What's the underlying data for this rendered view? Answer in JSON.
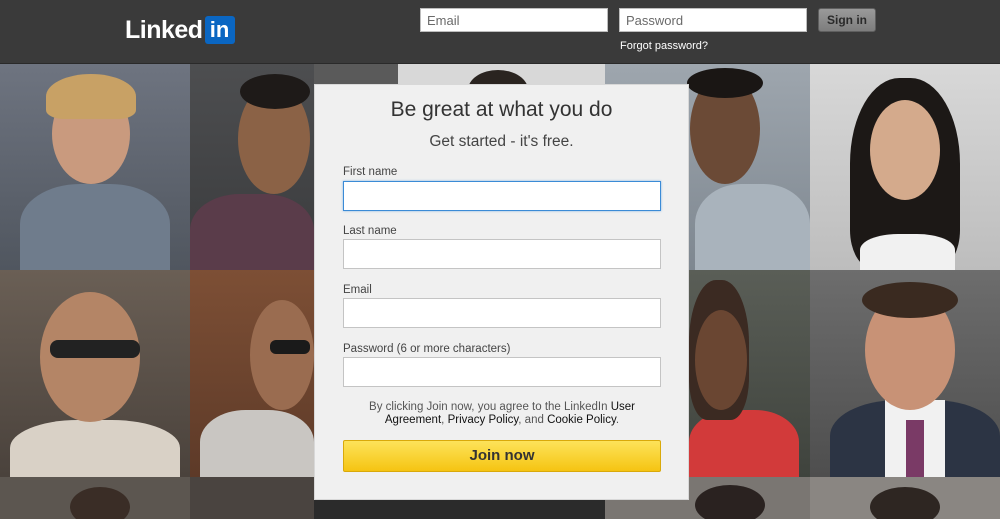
{
  "header": {
    "logo_text": "Linked",
    "logo_box": "in",
    "email_placeholder": "Email",
    "password_placeholder": "Password",
    "signin_label": "Sign in",
    "forgot_label": "Forgot password?"
  },
  "signup": {
    "title": "Be great at what you do",
    "subtitle": "Get started - it's free.",
    "fields": [
      {
        "label": "First name",
        "value": ""
      },
      {
        "label": "Last name",
        "value": ""
      },
      {
        "label": "Email",
        "value": ""
      },
      {
        "label": "Password (6 or more characters)",
        "value": ""
      }
    ],
    "terms_prefix": "By clicking Join now, you agree to the LinkedIn",
    "terms_user_agreement": "User Agreement",
    "terms_sep1": ",",
    "terms_privacy": "Privacy Policy",
    "terms_sep2": ", and",
    "terms_cookie": "Cookie Policy",
    "terms_end": ".",
    "join_label": "Join now"
  },
  "colors": {
    "topbar": "#3a3a3a",
    "brand_blue": "#0a66c2",
    "join_yellow": "#f5c412",
    "focus_border": "#3b8bd6"
  }
}
